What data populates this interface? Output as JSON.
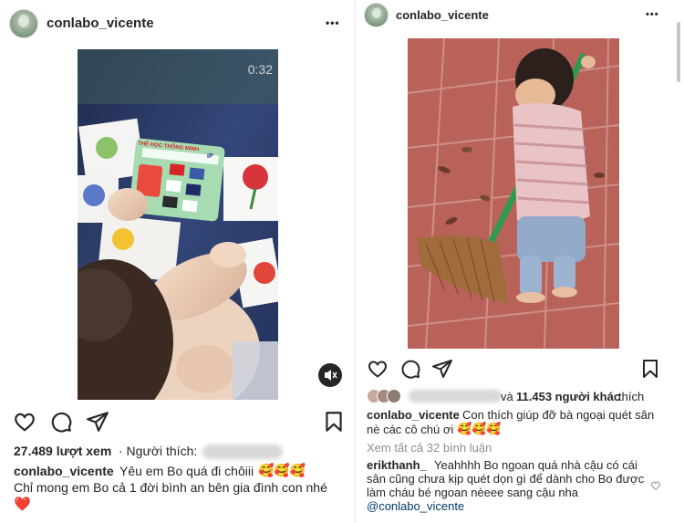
{
  "left_post": {
    "username": "conlabo_vicente",
    "more_label": "•••",
    "video_timer": "0:32",
    "card_title": "THẺ HỌC THÔNG MINH",
    "card_logo": "iP",
    "views": "27.489 lượt xem",
    "liked_by_label": "· Người thích:",
    "caption_user": "conlabo_vicente",
    "caption_line1": "Yêu em Bo quá đi chôiii",
    "caption_emojis": "🥰🥰🥰",
    "caption_line2": "Chỉ mong em Bo cả 1 đời bình an bên gia đình con nhé",
    "caption_heart": "❤️"
  },
  "right_post": {
    "username": "conlabo_vicente",
    "more_label": "•••",
    "likes_prefix": "và",
    "likes_count": "11.453 người khác",
    "likes_suffix": "thích",
    "caption_user": "conlabo_vicente",
    "caption_line1": "Con thích giúp đỡ bà ngoại quét sân",
    "caption_line2": "nè các cô chú ơi",
    "caption_emojis": "🥰🥰🥰",
    "view_comments": "Xem tất cả 32 bình luận",
    "comment_user": "erikthanh_",
    "comment_line1": "Yeahhhh Bo ngoan quá nhà cậu có cái",
    "comment_line2": "sân cũng chưa kịp quét dọn gì để dành cho Bo được",
    "comment_line3": "làm cháu bé ngoan nèeee sang cậu nha",
    "comment_mention": "@conlabo_vicente"
  },
  "icons": [
    "heart-icon",
    "comment-icon",
    "share-icon",
    "bookmark-icon",
    "more-icon",
    "mute-icon"
  ],
  "colors": {
    "text": "#262626",
    "secondary": "#8e8e8e",
    "link": "#00376b",
    "heart": "#e0242e"
  }
}
